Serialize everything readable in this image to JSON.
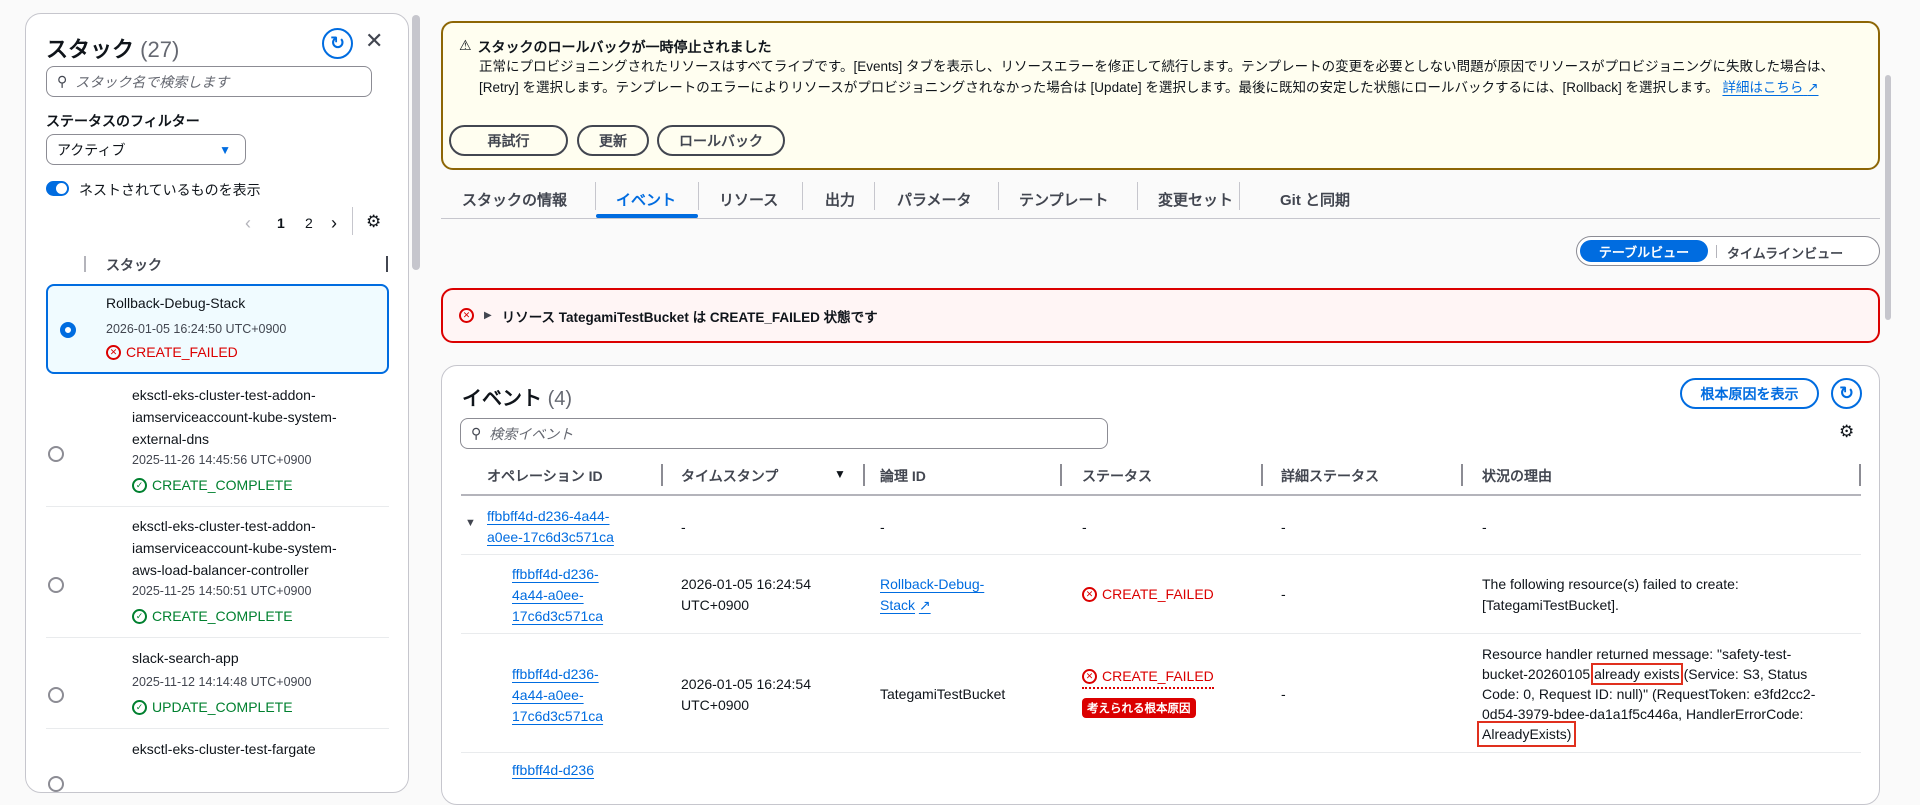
{
  "sidebar": {
    "title": "スタック",
    "count": "(27)",
    "search_placeholder": "スタック名で検索します",
    "filter_label": "ステータスのフィルター",
    "filter_value": "アクティブ",
    "nested_toggle_label": "ネストされているものを表示",
    "nested_toggle_on": true,
    "pages": [
      "1",
      "2"
    ],
    "column_header": "スタック",
    "stacks": [
      {
        "name": "Rollback-Debug-Stack",
        "date": "2026-01-05 16:24:50 UTC+0900",
        "status": "CREATE_FAILED",
        "selected": true
      },
      {
        "name": "eksctl-eks-cluster-test-addon-iamserviceaccount-kube-system-external-dns",
        "date": "2025-11-26 14:45:56 UTC+0900",
        "status": "CREATE_COMPLETE"
      },
      {
        "name": "eksctl-eks-cluster-test-addon-iamserviceaccount-kube-system-aws-load-balancer-controller",
        "date": "2025-11-25 14:50:51 UTC+0900",
        "status": "CREATE_COMPLETE"
      },
      {
        "name": "slack-search-app",
        "date": "2025-11-12 14:14:48 UTC+0900",
        "status": "UPDATE_COMPLETE"
      },
      {
        "name": "eksctl-eks-cluster-test-fargate"
      }
    ]
  },
  "alert": {
    "title": "スタックのロールバックが一時停止されました",
    "body": "正常にプロビジョニングされたリソースはすべてライブです。[Events] タブを表示し、リソースエラーを修正して続行します。テンプレートの変更を必要としない問題が原因でリソースがプロビジョニングに失敗した場合は、[Retry] を選択します。テンプレートのエラーによりリソースがプロビジョニングされなかった場合は [Update] を選択します。最後に既知の安定した状態にロールバックするには、[Rollback] を選択します。",
    "link": "詳細はこちら",
    "buttons": {
      "retry": "再試行",
      "update": "更新",
      "rollback": "ロールバック"
    }
  },
  "tabs": [
    "スタックの情報",
    "イベント",
    "リソース",
    "出力",
    "パラメータ",
    "テンプレート",
    "変更セット",
    "Git と同期"
  ],
  "active_tab": "イベント",
  "view_toggle": {
    "table": "テーブルビュー",
    "timeline": "タイムラインビュー"
  },
  "error_banner": "リソース TategamiTestBucket は CREATE_FAILED 状態です",
  "events": {
    "title": "イベント",
    "count": "(4)",
    "root_cause_button": "根本原因を表示",
    "search_placeholder": "検索イベント",
    "columns": [
      "オペレーション ID",
      "タイムスタンプ",
      "論理 ID",
      "ステータス",
      "詳細ステータス",
      "状況の理由"
    ],
    "group": {
      "op_id": "ffbbff4d-d236-4a44-a0ee-17c6d3c571ca",
      "dash": "-"
    },
    "rows": [
      {
        "op_id": "ffbbff4d-d236-4a44-a0ee-17c6d3c571ca",
        "timestamp": "2026-01-05 16:24:54 UTC+0900",
        "logical_id": "Rollback-Debug-Stack",
        "status": "CREATE_FAILED",
        "detail": "-",
        "reason": "The following resource(s) failed to create: [TategamiTestBucket]."
      },
      {
        "op_id": "ffbbff4d-d236-4a44-a0ee-17c6d3c571ca",
        "timestamp": "2026-01-05 16:24:54 UTC+0900",
        "logical_id": "TategamiTestBucket",
        "status": "CREATE_FAILED",
        "badge": "考えられる根本原因",
        "detail": "-",
        "reason_pre": "Resource handler returned message: \"safety-test-bucket-20260105 ",
        "reason_hl1": "already exists",
        "reason_mid": " (Service: S3, Status Code: 0, Request ID: null)\" (RequestToken: e3fd2cc2-0d54-3979-bdee-da1a1f5c446a, HandlerErrorCode: ",
        "reason_hl2": "AlreadyExists)"
      }
    ],
    "partial_row_op_id": "ffbbff4d-d236"
  },
  "colors": {
    "accent": "#006ce0",
    "error": "#db0000",
    "success": "#00802f",
    "warning_border": "#8d6605"
  }
}
